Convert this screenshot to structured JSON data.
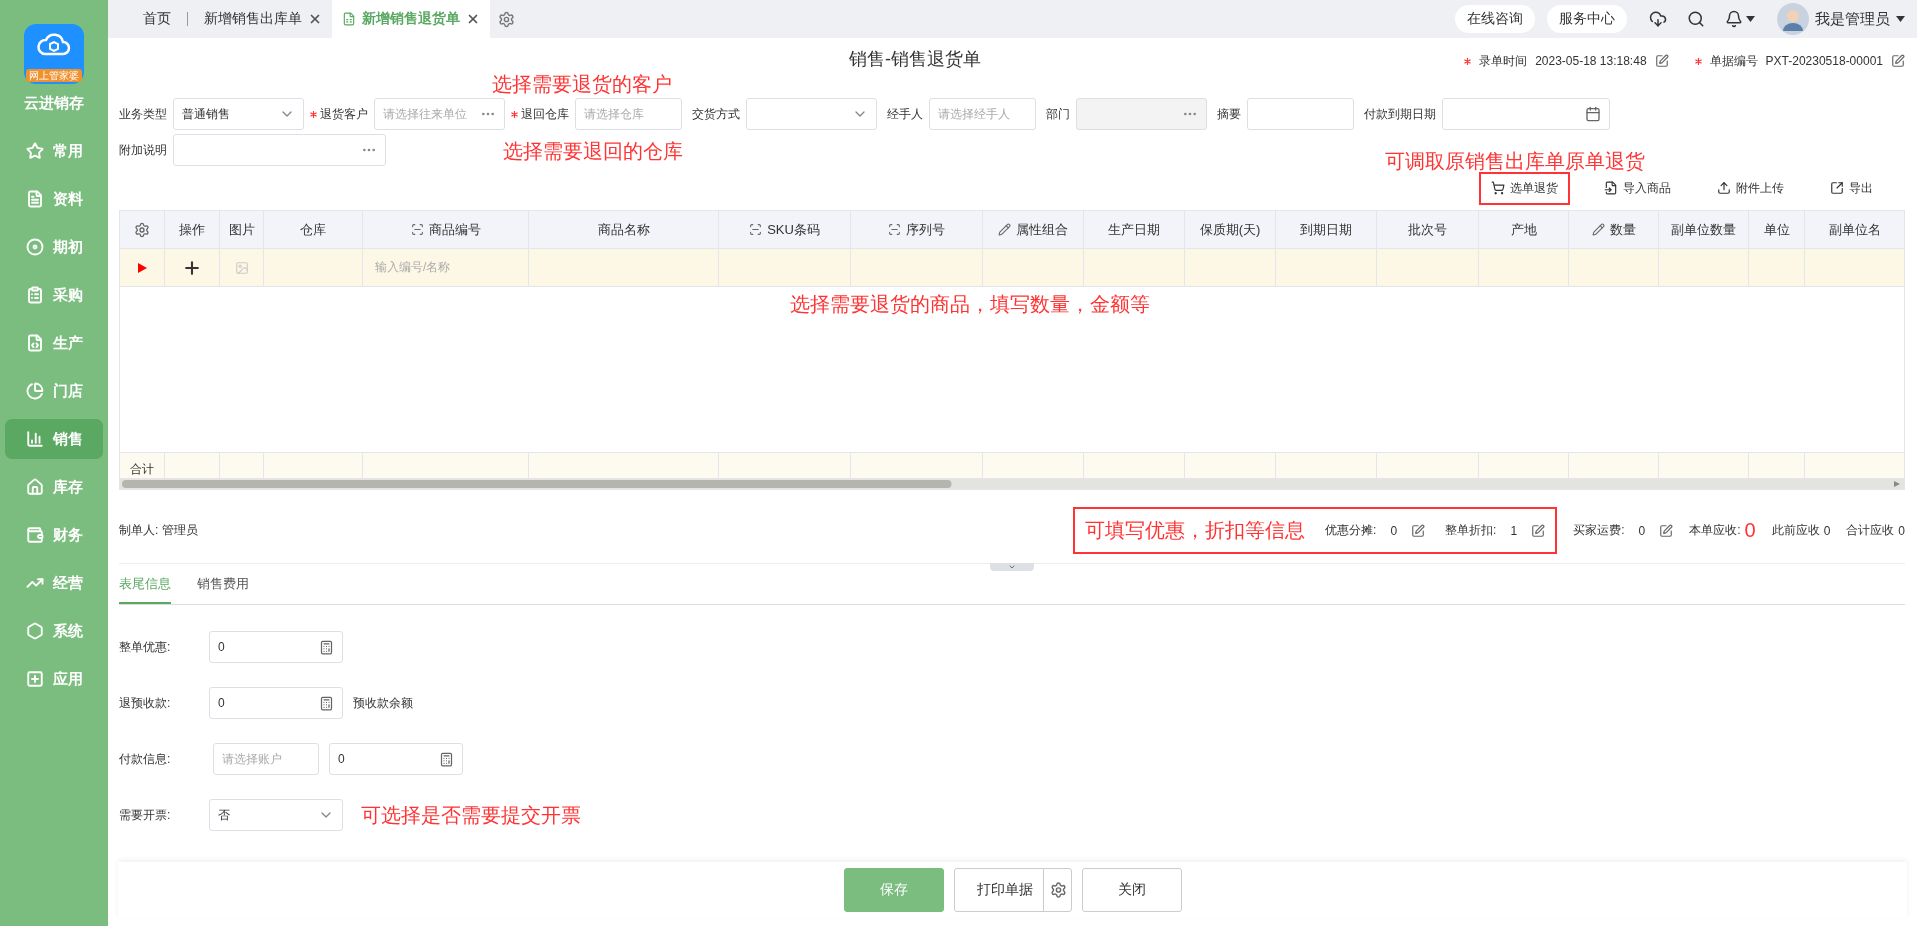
{
  "app": {
    "name": "云进销存",
    "logo_badge": "网上管家婆"
  },
  "sidebar": {
    "items": [
      {
        "label": "常用",
        "selected": false
      },
      {
        "label": "资料",
        "selected": false
      },
      {
        "label": "期初",
        "selected": false
      },
      {
        "label": "采购",
        "selected": false
      },
      {
        "label": "生产",
        "selected": false
      },
      {
        "label": "门店",
        "selected": false
      },
      {
        "label": "销售",
        "selected": true
      },
      {
        "label": "库存",
        "selected": false
      },
      {
        "label": "财务",
        "selected": false
      },
      {
        "label": "经营",
        "selected": false
      },
      {
        "label": "系统",
        "selected": false
      },
      {
        "label": "应用",
        "selected": false
      }
    ]
  },
  "tabs": [
    {
      "label": "首页",
      "selected": false,
      "closable": false
    },
    {
      "label": "新增销售出库单",
      "selected": false,
      "closable": true
    },
    {
      "label": "新增销售退货单",
      "selected": true,
      "closable": true
    }
  ],
  "header": {
    "links": [
      "在线咨询",
      "服务中心"
    ],
    "user": "我是管理员"
  },
  "page_title": "销售-销售退货单",
  "meta": [
    {
      "label": "录单时间",
      "value": "2023-05-18 13:18:48",
      "required": true
    },
    {
      "label": "单据编号",
      "value": "PXT-20230518-00001",
      "required": true
    }
  ],
  "form_rows": [
    [
      {
        "label": "业务类型",
        "kind": "select",
        "value": "普通销售",
        "required": false,
        "disabled": false
      },
      {
        "label": "退货客户",
        "kind": "picker",
        "placeholder": "请选择往来单位",
        "required": true,
        "disabled": false
      },
      {
        "label": "退回仓库",
        "kind": "text",
        "placeholder": "请选择仓库",
        "required": true,
        "disabled": false
      },
      {
        "label": "交货方式",
        "kind": "select",
        "required": false,
        "disabled": false
      },
      {
        "label": "经手人",
        "kind": "text",
        "placeholder": "请选择经手人",
        "required": false,
        "disabled": false
      },
      {
        "label": "部门",
        "kind": "picker",
        "required": false,
        "disabled": true
      },
      {
        "label": "摘要",
        "kind": "text",
        "required": false,
        "disabled": false
      },
      {
        "label": "付款到期日期",
        "kind": "date",
        "required": false,
        "disabled": false
      }
    ],
    [
      {
        "label": "附加说明",
        "kind": "picker",
        "required": false,
        "disabled": false
      }
    ]
  ],
  "annotations": {
    "customer": "选择需要退货的客户",
    "warehouse": "选择需要退回的仓库",
    "toolbar": "可调取原销售出库单原单退货",
    "table": "选择需要退货的商品，填写数量，金额等",
    "invoice": "可选择是否需要提交开票"
  },
  "toolbar": [
    {
      "label": "选单退货",
      "highlighted": true
    },
    {
      "label": "导入商品",
      "highlighted": false
    },
    {
      "label": "附件上传",
      "highlighted": false
    },
    {
      "label": "导出",
      "highlighted": false
    }
  ],
  "table": {
    "columns": [
      {
        "label": "操作",
        "kind": "plain"
      },
      {
        "label": "图片",
        "kind": "plain"
      },
      {
        "label": "仓库",
        "kind": "plain"
      },
      {
        "label": "商品编号",
        "kind": "scan"
      },
      {
        "label": "商品名称",
        "kind": "plain"
      },
      {
        "label": "SKU条码",
        "kind": "scan"
      },
      {
        "label": "序列号",
        "kind": "scan"
      },
      {
        "label": "属性组合",
        "kind": "edit"
      },
      {
        "label": "生产日期",
        "kind": "plain"
      },
      {
        "label": "保质期(天)",
        "kind": "plain"
      },
      {
        "label": "到期日期",
        "kind": "plain"
      },
      {
        "label": "批次号",
        "kind": "plain"
      },
      {
        "label": "产地",
        "kind": "plain"
      },
      {
        "label": "数量",
        "kind": "edit"
      },
      {
        "label": "副单位数量",
        "kind": "plain"
      },
      {
        "label": "单位",
        "kind": "plain"
      },
      {
        "label": "副单位名",
        "kind": "plain"
      }
    ],
    "rows": [
      {
        "current": true,
        "code_placeholder": "输入编号/名称"
      }
    ],
    "total_label": "合计"
  },
  "summary": {
    "maker_label": "制单人:",
    "maker": "管理员",
    "boxed": {
      "annotation": "可填写优惠，折扣等信息",
      "items": [
        {
          "label": "优惠分摊:",
          "value": "0",
          "editable": true
        },
        {
          "label": "整单折扣:",
          "value": "1",
          "editable": true
        }
      ]
    },
    "items": [
      {
        "label": "买家运费:",
        "value": "0",
        "editable": true,
        "emphasis": false
      },
      {
        "label": "本单应收:",
        "value": "0",
        "editable": false,
        "emphasis": true
      },
      {
        "label": "此前应收",
        "value": "0",
        "editable": false,
        "emphasis": false
      },
      {
        "label": "合计应收",
        "value": "0",
        "editable": false,
        "emphasis": false
      }
    ]
  },
  "bottom_tabs": [
    {
      "label": "表尾信息",
      "selected": true
    },
    {
      "label": "销售费用",
      "selected": false
    }
  ],
  "footer_fields": [
    {
      "label": "整单优惠:",
      "kind": "number",
      "value": "0"
    },
    {
      "label": "退预收款:",
      "kind": "number",
      "value": "0",
      "note": "预收款余额"
    },
    {
      "label": "付款信息:",
      "kind": "account",
      "placeholder": "请选择账户",
      "value": "0"
    },
    {
      "label": "需要开票:",
      "kind": "select",
      "value": "否"
    }
  ],
  "buttons": [
    {
      "label": "保存",
      "kind": "primary"
    },
    {
      "label": "打印单据",
      "kind": "split"
    },
    {
      "label": "关闭",
      "kind": "default"
    }
  ]
}
